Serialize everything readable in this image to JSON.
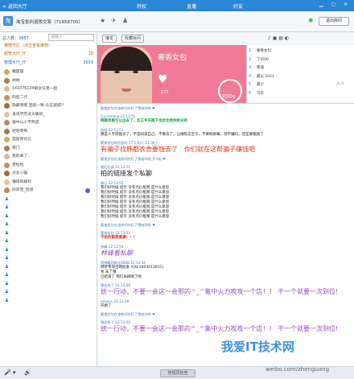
{
  "topbar": {
    "back_label": "< 返回大厅",
    "tabs": [
      "特权",
      "直播",
      "好友"
    ],
    "window_controls": "▁ ▢ ✕"
  },
  "room": {
    "title": "淘宝批判退税交易（71858705）",
    "exit_label": "退出房间",
    "icons": [
      "star-icon",
      "plane-icon",
      "add-user-icon"
    ]
  },
  "left": {
    "online_label": "总人数：",
    "online_count": "3887",
    "search_placeholder": "请输入",
    "groups": [
      {
        "label": "推荐专区（点击查看推荐）",
        "count": ""
      },
      {
        "label": "超管大厅_厅",
        "count": "18"
      },
      {
        "label": "管理大厅_厅",
        "count": "3659"
      }
    ],
    "users": [
      "曦甜甜",
      "纳纳",
      "141076124解女兄弟一起",
      "的爸二代",
      "隐藏到哦 团结一致 众志诚城!!",
      "发哥学历天天嘛的_",
      "缓中山小学商店",
      "轻轻草莓",
      "茵茵爽比比",
      "零门",
      "我的单丁",
      "雪粒粒",
      "对女小猫",
      "懂得和解料",
      "好声音_慌感",
      "",
      "",
      "",
      "",
      "",
      "",
      "",
      "",
      "",
      "",
      "",
      "",
      ""
    ]
  },
  "toolbar": {
    "btn1": "接龙",
    "btn2": "收藏房间"
  },
  "video": {
    "anchor_name": "奢香女包",
    "heart_count": "172",
    "seconds": "300s"
  },
  "rlist": [
    {
      "no": "1",
      "name": "奢香女包",
      "tail": ""
    },
    {
      "no": "2",
      "name": "了华00",
      "tail": ""
    },
    {
      "no": "3",
      "name": "稳诚",
      "tail": ""
    },
    {
      "no": "4",
      "name": "最火 2021",
      "tail": ""
    },
    {
      "no": "5",
      "name": "最小",
      "tail": "_a_0"
    },
    {
      "no": "6",
      "name": "乌云",
      "tail": ""
    }
  ],
  "chat": [
    {
      "hd": "奢香女包在该房间内打了赞给你的 ❤",
      "bd": "",
      "hdstyle": "sys"
    },
    {
      "hd": "Lucisenlina 22:13:51",
      "bd": "韩都老板可以出去了，反正今天跑下也会全给你抢光的",
      "bdstyle": "greenb"
    },
    {
      "hd": "拍拍 22:13:51",
      "bd": "算是人不得能去了，不是知道自己，不要去了，让做陈实至于，不要刷屏幕，领不懂吗，还是要随随了",
      "bdstyle": ""
    },
    {
      "hd": "奢香女包的信息的 17:1:03 (-11:30 )",
      "bd": "有骗子找韩都衣舍要钱去了　你们就在这帮骗子赚钱吧",
      "bdstyle": "bigred"
    },
    {
      "hd": "奢香女包在该房间内打了赞给你的_0:1的 ❤",
      "bd": "",
      "hdstyle": "sys"
    },
    {
      "hd": "我们在说 22:13:52",
      "bd": "拍的链接发个私聊",
      "bdstyle": "big"
    },
    {
      "hd": "精心 22:13:52",
      "bd": "我们好时候 提示 没有点价框限 是什么意思\n我们好时候 提示 没有点价框限 是什么意思\n我们好时候 提示 没有点价框限 是什么意思\n我们好时候 提示 没有点价框限 是什么意思\n我们好时候 提示 没有点价框限 是什么意思\n我们好时候 提示 没有点价框限 是什么意思\n我们好时候 提示 没有点价框限 是什么意思",
      "bdstyle": ""
    },
    {
      "hd": "奢香女包在该房间内打了赞给你的 ❤",
      "bd": "",
      "hdstyle": "sys"
    },
    {
      "hd": "奢香女包 22:13:53",
      "bd": "不给的都是傻逼！！！",
      "bdstyle": "redb"
    },
    {
      "hd": "林峰 22:13:54",
      "bd": "林峰看私聊",
      "bdstyle": "purple big ital"
    },
    {
      "hd": "闯神集团报告5668 22:13:54",
      "bd": "韩梦茶淘宝网批发 (QQ:1603013811)\n余  末了哦\n已结束了 我们再刷啊了呢",
      "bdstyle": ""
    },
    {
      "hd": "锤白东了 22:13:58",
      "bd": "统一行动，不要一会这一会那的^_^集中火力攻攻一个店！！ 干一个就要一次到位!",
      "bdstyle": "purple big"
    },
    {
      "hd": "anyuns 22:13:56",
      "bd": "开始了",
      "bdstyle": ""
    },
    {
      "hd": "奢香女包在该房间内打了赞给你的 ❤",
      "bd": "",
      "hdstyle": "sys"
    },
    {
      "hd": "锤白东了 22:13:56",
      "bd": "统一行动，不要一会这一会那的^_^集中火力攻攻一个店！！ 干一个就要一次到位!",
      "bdstyle": "purple big"
    }
  ],
  "bottom": {
    "manage_label": "管理员检查"
  },
  "watermark": {
    "cn": "我爱IT技术网",
    "url": "weibo.com/zhenguang"
  }
}
